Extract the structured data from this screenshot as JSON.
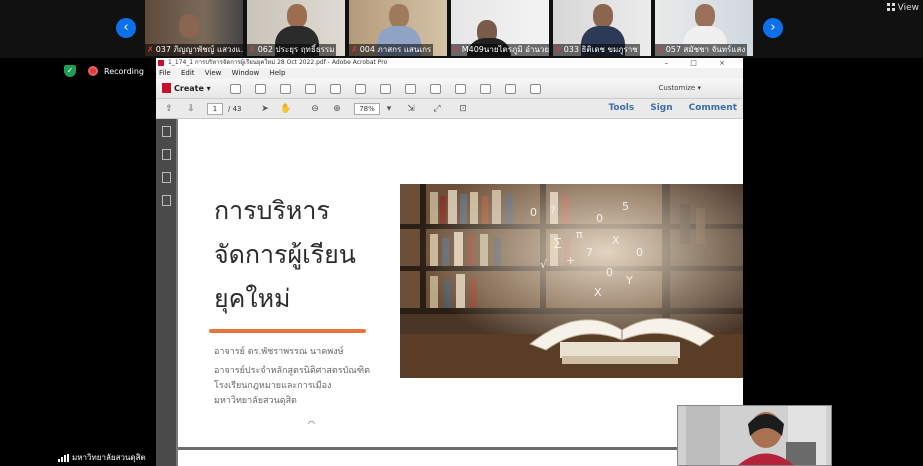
{
  "gallery": {
    "participants": [
      {
        "name": "037 ภิญญาพัชญ์ แสวงแ...",
        "muted": true
      },
      {
        "name": "062 ประยุร ฤทธิ์ธรรม",
        "muted": true
      },
      {
        "name": "004 ภาสกร แสนเกร",
        "muted": true
      },
      {
        "name": "M409นายไตรภูมิ อำนวยค์",
        "muted": true
      },
      {
        "name": "033 ธิติเดช ขมภูราช",
        "muted": true
      },
      {
        "name": "057 สมัชชา จันทร์แสง",
        "muted": true
      }
    ],
    "prev_arrow": "‹",
    "next_arrow": "›"
  },
  "view_button": {
    "label": "View",
    "icon": "grid-icon"
  },
  "status": {
    "recording_label": "Recording",
    "security_icon": "shield-icon"
  },
  "acrobat": {
    "title": "1_174_1 การบริหารจัดการผู้เรียนยุคใหม่ 28 Oct 2022.pdf - Adobe Acrobat Pro",
    "window_controls": "– □ ×",
    "menu": [
      "File",
      "Edit",
      "View",
      "Window",
      "Help"
    ],
    "create_label": "Create",
    "customize_label": "Customize",
    "page_current": "1",
    "page_total": "/ 43",
    "zoom": "78%",
    "right_tabs": [
      "Tools",
      "Sign",
      "Comment"
    ]
  },
  "slide": {
    "title_lines": [
      "การบริหาร",
      "จัดการผู้เรียน",
      "ยุคใหม่"
    ],
    "lecturer": "อาจารย์ ดร.พัชราพรรณ นาคพงษ์",
    "affiliation_lines": [
      "อาจารย์ประจำหลักสูตรนิติศาสตรบัณฑิต",
      "โรงเรียนกฎหมายและการเมือง",
      "มหาวิทยาลัยสวนดุสิต"
    ]
  },
  "speaker": {
    "name": "มหาวิทยาลัยสวนดุสิต"
  },
  "colors": {
    "zoom_blue": "#0e71eb",
    "mic_muted": "#e23b3b",
    "accent_orange": "#e8743b",
    "acrobat_red": "#c8102e"
  }
}
